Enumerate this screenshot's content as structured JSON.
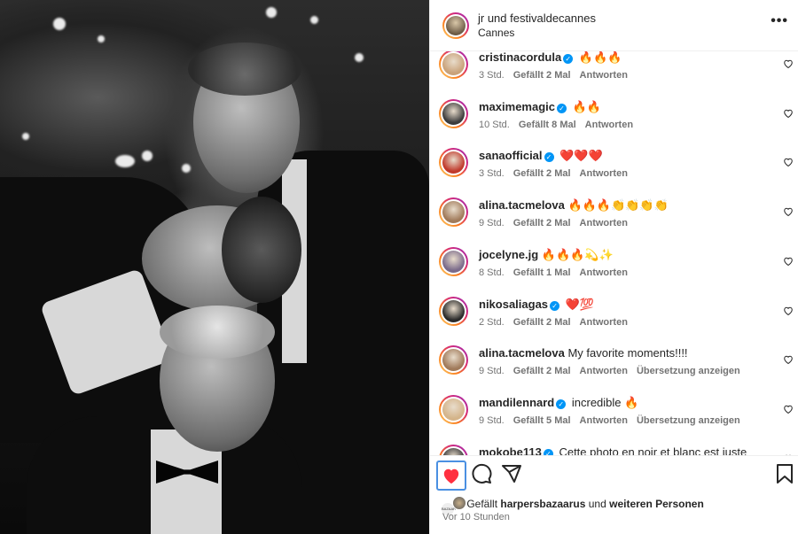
{
  "post": {
    "author": "jr",
    "coauthor_joiner": " und ",
    "coauthor": "festivaldecannes",
    "location": "Cannes",
    "more_icon": "more-horizontal-icon"
  },
  "comments": [
    {
      "user": "cristinacordula",
      "verified": true,
      "text": "🔥🔥🔥",
      "time": "3 Std.",
      "likes": "Gefällt 2 Mal",
      "reply": "Antworten",
      "translate": "",
      "avatar_color": "#c9a27a"
    },
    {
      "user": "maximemagic",
      "verified": true,
      "text": "🔥🔥",
      "time": "10 Std.",
      "likes": "Gefällt 8 Mal",
      "reply": "Antworten",
      "translate": "",
      "avatar_color": "#3c3c3c"
    },
    {
      "user": "sanaofficial",
      "verified": true,
      "text": "❤️❤️❤️",
      "time": "3 Std.",
      "likes": "Gefällt 2 Mal",
      "reply": "Antworten",
      "translate": "",
      "avatar_color": "#c0392b"
    },
    {
      "user": "alina.tacmelova",
      "verified": false,
      "text": "🔥🔥🔥👏👏👏👏",
      "time": "9 Std.",
      "likes": "Gefällt 2 Mal",
      "reply": "Antworten",
      "translate": "",
      "avatar_color": "#a07a5a"
    },
    {
      "user": "jocelyne.jg",
      "verified": false,
      "text": "🔥🔥🔥💫✨",
      "time": "8 Std.",
      "likes": "Gefällt 1 Mal",
      "reply": "Antworten",
      "translate": "",
      "avatar_color": "#7a6a8a"
    },
    {
      "user": "nikosaliagas",
      "verified": true,
      "text": "❤️💯",
      "time": "2 Std.",
      "likes": "Gefällt 2 Mal",
      "reply": "Antworten",
      "translate": "",
      "avatar_color": "#2a2a2a"
    },
    {
      "user": "alina.tacmelova",
      "verified": false,
      "text": "My favorite moments!!!!",
      "time": "9 Std.",
      "likes": "Gefällt 2 Mal",
      "reply": "Antworten",
      "translate": "Übersetzung anzeigen",
      "avatar_color": "#a07a5a"
    },
    {
      "user": "mandilennard",
      "verified": true,
      "text": "incredible 🔥",
      "time": "9 Std.",
      "likes": "Gefällt 5 Mal",
      "reply": "Antworten",
      "translate": "Übersetzung anzeigen",
      "avatar_color": "#d4b48a"
    },
    {
      "user": "mokobe113",
      "verified": true,
      "text": "Cette photo en noir et blanc est juste",
      "time": "",
      "likes": "",
      "reply": "",
      "translate": "",
      "avatar_color": "#333333"
    }
  ],
  "actions": {
    "like_icon": "heart-filled-icon",
    "comment_icon": "comment-icon",
    "share_icon": "send-icon",
    "save_icon": "bookmark-icon",
    "liked_color": "#ff3040"
  },
  "likes": {
    "prefix": "Gefällt ",
    "user": "harpersbazaarus",
    "middle": " und ",
    "rest": "weiteren Personen",
    "mini_avatar_label": "BAZAAR"
  },
  "posted_ago": "Vor 10 Stunden"
}
